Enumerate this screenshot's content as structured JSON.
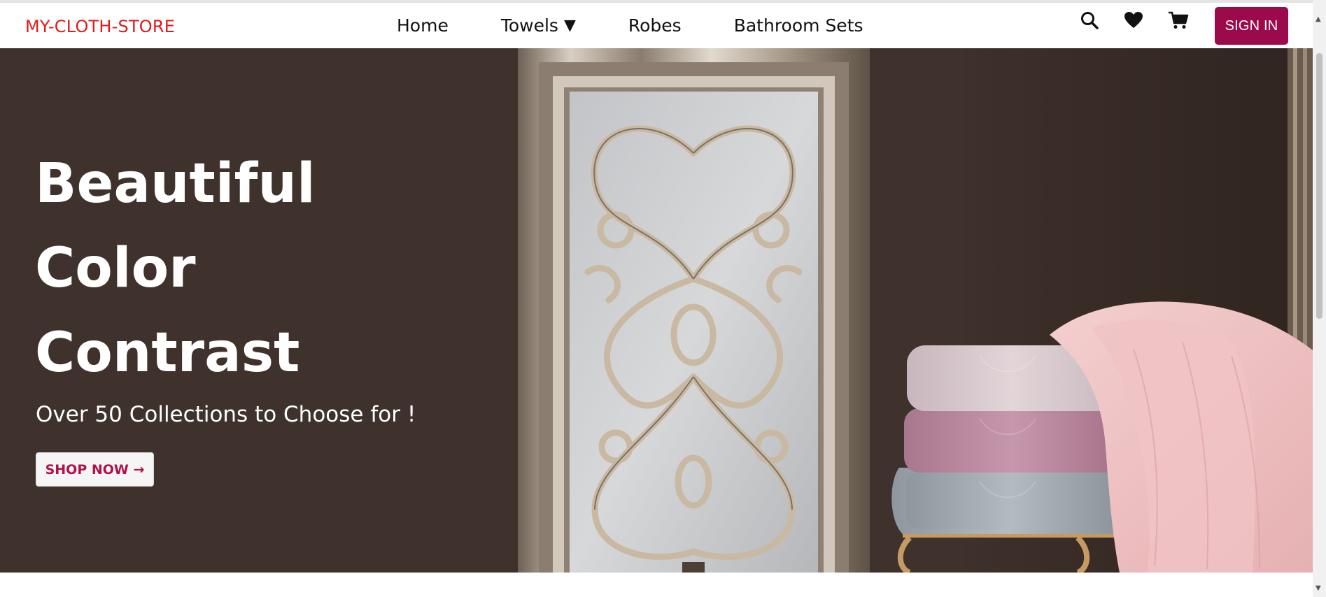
{
  "navbar": {
    "brand": "MY-CLOTH-STORE",
    "links": [
      {
        "label": "Home"
      },
      {
        "label": "Towels",
        "caret": "▼"
      },
      {
        "label": "Robes"
      },
      {
        "label": "Bathroom Sets"
      }
    ],
    "icons": [
      "search-icon",
      "heart-icon",
      "cart-icon"
    ],
    "signin_label": "SIGN IN"
  },
  "hero": {
    "title_lines": [
      "Beautiful",
      "Color",
      "Contrast"
    ],
    "subtitle": "Over 50 Collections to Choose for !",
    "cta_label": "SHOP NOW →"
  },
  "colors": {
    "brand": "#e01b1b",
    "accent": "#9b0a4a",
    "hero_bg": "#3f322d",
    "cta_text": "#b0124c"
  }
}
